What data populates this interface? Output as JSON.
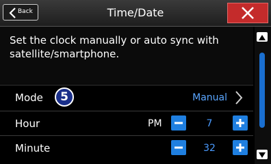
{
  "header": {
    "back_label": "Back",
    "title": "Time/Date",
    "close_icon": "close-icon"
  },
  "description": "Set the clock manually or auto sync with satellite/smartphone.",
  "rows": {
    "mode": {
      "label": "Mode",
      "badge": "5",
      "value": "Manual"
    },
    "hour": {
      "label": "Hour",
      "ampm": "PM",
      "value": "7"
    },
    "minute": {
      "label": "Minute",
      "value": "32"
    }
  },
  "colors": {
    "accent": "#1f7fe0",
    "close": "#c42b2b",
    "value_text": "#5aa6ff"
  }
}
